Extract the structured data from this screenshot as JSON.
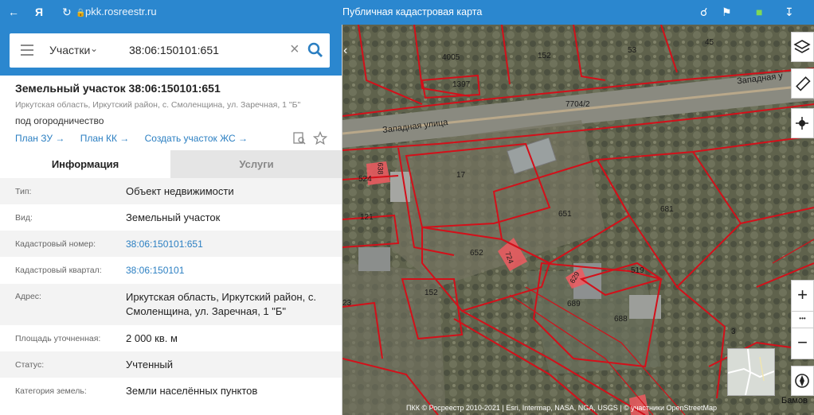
{
  "browser": {
    "url": "pkk.rosreestr.ru",
    "title": "Публичная кадастровая карта"
  },
  "search": {
    "category": "Участки",
    "query": "38:06:150101:651"
  },
  "parcel": {
    "title": "Земельный участок 38:06:150101:651",
    "address_short": "Иркутская область, Иркутский район, с. Смоленщина, ул. Заречная, 1 \"Б\"",
    "purpose": "под огородничество",
    "links": [
      "План ЗУ →",
      "План КК →",
      "Создать участок ЖС →"
    ]
  },
  "tabs": [
    "Информация",
    "Услуги"
  ],
  "info_rows": [
    {
      "label": "Тип:",
      "value": "Объект недвижимости"
    },
    {
      "label": "Вид:",
      "value": "Земельный участок"
    },
    {
      "label": "Кадастровый номер:",
      "value": "38:06:150101:651"
    },
    {
      "label": "Кадастровый квартал:",
      "value": "38:06:150101"
    },
    {
      "label": "Адрес:",
      "value": "Иркутская область, Иркутский район, с. Смоленщина, ул. Заречная, 1 \"Б\""
    },
    {
      "label": "Площадь уточненная:",
      "value": "2 000 кв. м"
    },
    {
      "label": "Статус:",
      "value": "Учтенный"
    },
    {
      "label": "Категория земель:",
      "value": "Земли населённых пунктов"
    }
  ],
  "map": {
    "streets": [
      "Западная улица",
      "Западная у"
    ],
    "road_label": "7704/2",
    "parcel_labels": [
      "4005",
      "152",
      "53",
      "45",
      "1397",
      "17",
      "524",
      "121",
      "651",
      "681",
      "652",
      "519",
      "689",
      "152",
      "688",
      "23",
      "3",
      "638",
      "724",
      "629"
    ],
    "attribution": "ПКК © Росреестр 2010-2021 | Esri, Intermap, NASA, NGA, USGS | © участники OpenStreetMap",
    "place": "Бамов",
    "zoom_in": "+",
    "zoom_out": "−",
    "more": "•••",
    "colors": {
      "parcel_border": "#d3101a",
      "highlight": "#f05a60"
    }
  },
  "icons": [
    "back-icon",
    "yandex-icon",
    "reload-icon",
    "lock-icon",
    "zoom-icon",
    "bookmark-icon",
    "extension-icon",
    "download-icon",
    "search-icon",
    "clear-icon",
    "collapse-icon",
    "layers-icon",
    "ruler-icon",
    "locate-icon",
    "compass-icon",
    "print-icon",
    "star-icon"
  ]
}
